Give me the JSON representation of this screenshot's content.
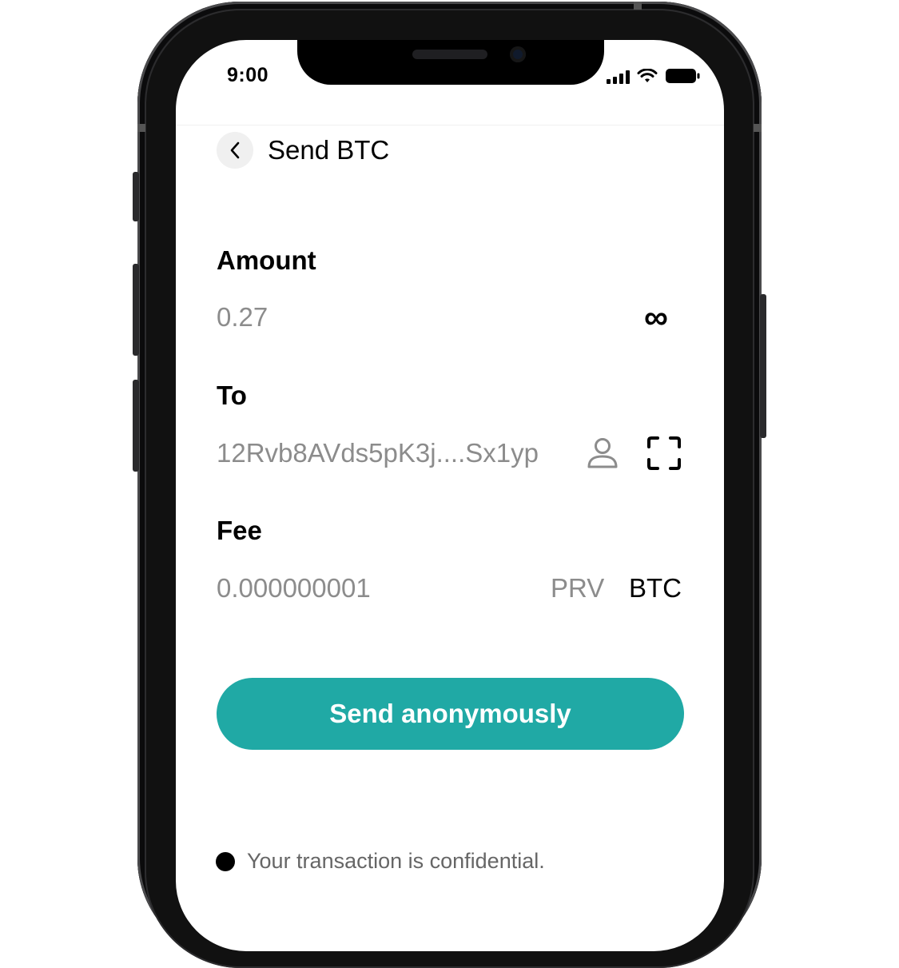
{
  "status_bar": {
    "time": "9:00"
  },
  "header": {
    "title": "Send BTC"
  },
  "amount": {
    "label": "Amount",
    "value": "0.27",
    "max_symbol": "∞"
  },
  "to": {
    "label": "To",
    "address": "12Rvb8AVds5pK3j....Sx1yp"
  },
  "fee": {
    "label": "Fee",
    "value": "0.000000001",
    "options": [
      "PRV",
      "BTC"
    ],
    "selected": "BTC"
  },
  "send_button": {
    "label": "Send anonymously",
    "color": "#20a9a5"
  },
  "footer": {
    "note": "Your transaction is confidential."
  },
  "icons": [
    "back-icon",
    "infinity-icon",
    "contact-icon",
    "scan-icon",
    "signal-icon",
    "wifi-icon",
    "battery-icon"
  ]
}
